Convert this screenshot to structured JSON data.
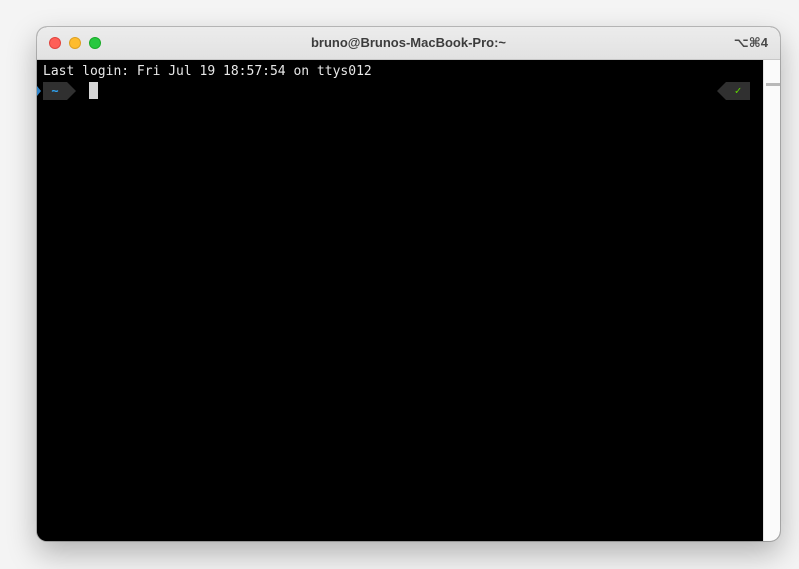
{
  "window": {
    "title": "bruno@Brunos-MacBook-Pro:~",
    "shortcut": "⌥⌘4"
  },
  "terminal": {
    "last_login": "Last login: Fri Jul 19 18:57:54 on ttys012",
    "prompt_dir": "~",
    "status_symbol": "✓"
  },
  "colors": {
    "background": "#000000",
    "prompt_dir": "#2fa4f4",
    "status_ok": "#5fd700",
    "close": "#fe5f57",
    "minimize": "#febc2e",
    "zoom": "#28c840"
  }
}
